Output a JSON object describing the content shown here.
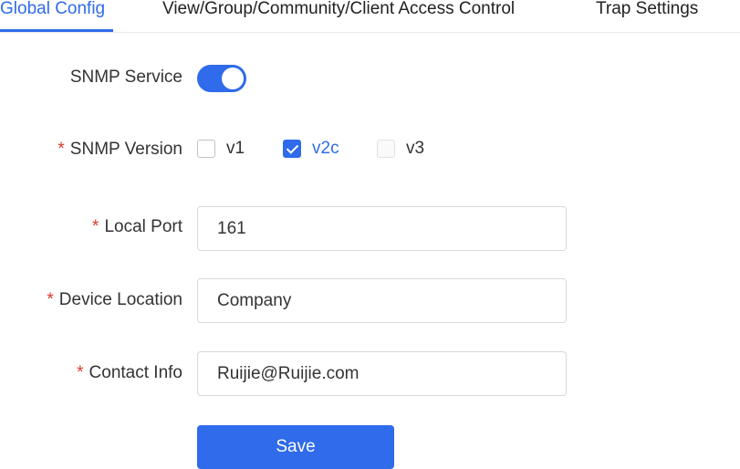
{
  "tabs": [
    {
      "label": "Global Config",
      "active": true
    },
    {
      "label": "View/Group/Community/Client Access Control",
      "active": false
    },
    {
      "label": "Trap Settings",
      "active": false
    }
  ],
  "form": {
    "snmp_service": {
      "label": "SNMP Service",
      "enabled": true
    },
    "snmp_version": {
      "required_mark": "*",
      "label": "SNMP Version",
      "options": [
        {
          "label": "v1",
          "checked": false,
          "disabled": false
        },
        {
          "label": "v2c",
          "checked": true,
          "disabled": false
        },
        {
          "label": "v3",
          "checked": false,
          "disabled": true
        }
      ]
    },
    "local_port": {
      "required_mark": "*",
      "label": "Local Port",
      "value": "161"
    },
    "device_location": {
      "required_mark": "*",
      "label": "Device Location",
      "value": "Company"
    },
    "contact_info": {
      "required_mark": "*",
      "label": "Contact Info",
      "value": "Ruijie@Ruijie.com"
    }
  },
  "save_label": "Save",
  "colors": {
    "primary": "#2f6bea",
    "required": "#e0392b",
    "text": "#333333",
    "border": "#d9d9d9"
  }
}
